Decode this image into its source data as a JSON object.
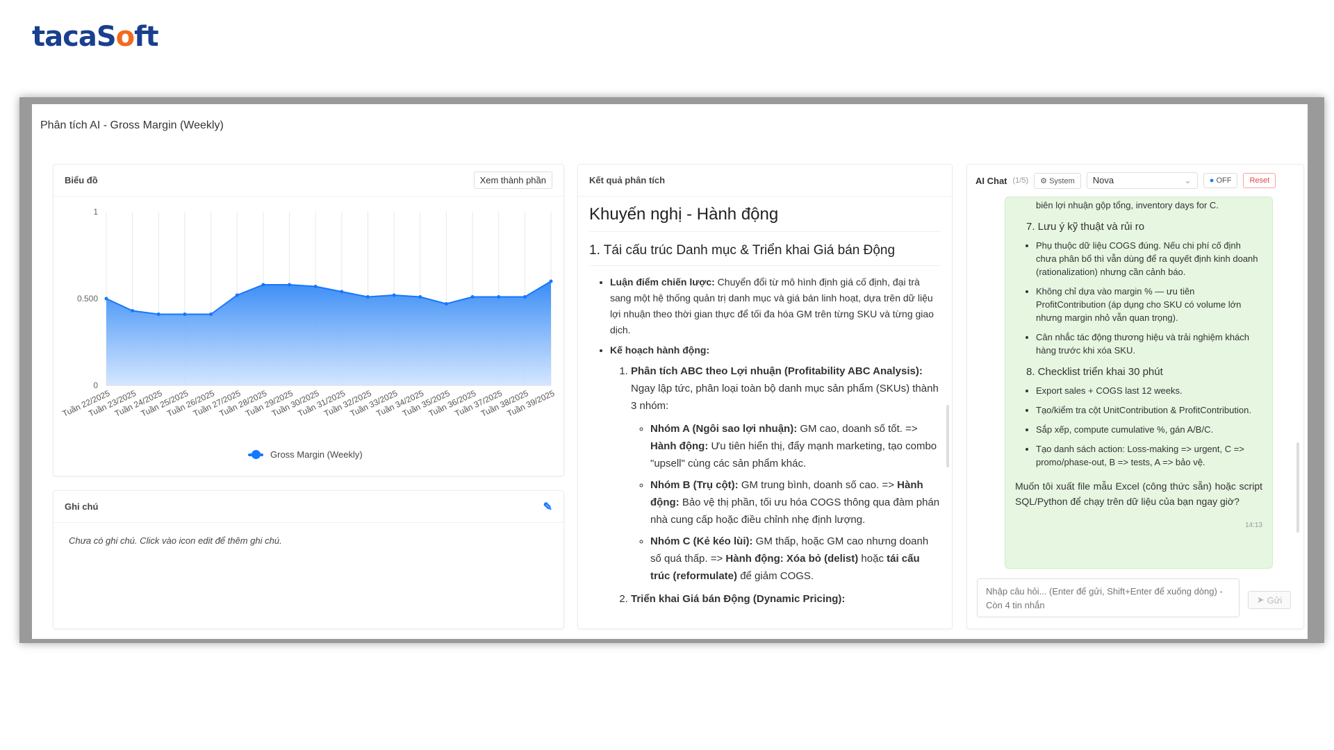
{
  "brand": {
    "name_before": "tacaS",
    "name_o": "o",
    "name_after": "ft"
  },
  "window": {
    "title": "Phân tích AI - Gross Margin (Weekly)"
  },
  "chart_panel": {
    "title": "Biểu đồ",
    "view_components_button": "Xem thành phần"
  },
  "chart_data": {
    "type": "area",
    "x": [
      "Tuần 22/2025",
      "Tuần 23/2025",
      "Tuần 24/2025",
      "Tuần 25/2025",
      "Tuần 26/2025",
      "Tuần 27/2025",
      "Tuần 28/2025",
      "Tuần 29/2025",
      "Tuần 30/2025",
      "Tuần 31/2025",
      "Tuần 32/2025",
      "Tuần 33/2025",
      "Tuần 34/2025",
      "Tuần 35/2025",
      "Tuần 36/2025",
      "Tuần 37/2025",
      "Tuần 38/2025",
      "Tuần 39/2025"
    ],
    "series": [
      {
        "name": "Gross Margin (Weekly)",
        "values": [
          0.5,
          0.43,
          0.41,
          0.41,
          0.41,
          0.52,
          0.58,
          0.58,
          0.57,
          0.54,
          0.51,
          0.52,
          0.51,
          0.47,
          0.51,
          0.51,
          0.51,
          0.6
        ]
      }
    ],
    "yticks": [
      "0",
      "0.500",
      "1"
    ],
    "ylim": [
      0,
      1
    ],
    "color": "#1677ff",
    "grid": "vertical",
    "legend": "bottom"
  },
  "notes_panel": {
    "title": "Ghi chú",
    "empty_text": "Chưa có ghi chú. Click vào icon edit để thêm ghi chú."
  },
  "result_panel": {
    "title": "Kết quả phân tích",
    "heading": "Khuyến nghị - Hành động",
    "section_title": "1. Tái cấu trúc Danh mục & Triển khai Giá bán Động",
    "strategy_label": "Luận điểm chiến lược:",
    "strategy_text": " Chuyển đổi từ mô hình định giá cố định, đại trà sang một hệ thống quản trị danh mục và giá bán linh hoạt, dựa trên dữ liệu lợi nhuận theo thời gian thực để tối đa hóa GM trên từng SKU và từng giao dịch.",
    "plan_label": "Kế hoạch hành động:",
    "step1_title": "Phân tích ABC theo Lợi nhuận (Profitability ABC Analysis):",
    "step1_text": " Ngay lập tức, phân loại toàn bộ danh mục sản phẩm (SKUs) thành 3 nhóm:",
    "groupA_label": "Nhóm A (Ngôi sao lợi nhuận):",
    "groupA_text": " GM cao, doanh số tốt. => ",
    "groupA_action_label": "Hành động:",
    "groupA_action": " Ưu tiên hiển thị, đẩy mạnh marketing, tạo combo \"upsell\" cùng các sản phẩm khác.",
    "groupB_label": "Nhóm B (Trụ cột):",
    "groupB_text": " GM trung bình, doanh số cao. => ",
    "groupB_action_label": "Hành động:",
    "groupB_action": " Bảo vệ thị phần, tối ưu hóa COGS thông qua đàm phán nhà cung cấp hoặc điều chỉnh nhẹ định lượng.",
    "groupC_label": "Nhóm C (Kẻ kéo lùi):",
    "groupC_text": " GM thấp, hoặc GM cao nhưng doanh số quá thấp. => ",
    "groupC_action_label": "Hành động: Xóa bỏ (delist)",
    "groupC_mid": " hoặc ",
    "groupC_reform": "tái cấu trúc (reformulate)",
    "groupC_end": " để giảm COGS.",
    "step2_title": "Triển khai Giá bán Động (Dynamic Pricing):"
  },
  "chat_panel": {
    "title": "AI Chat",
    "count": "(1/5)",
    "system_chip": "System",
    "model": "Nova",
    "toggle": "OFF",
    "reset": "Reset",
    "messages": {
      "line0": "biên lợi nhuận gộp tổng, inventory days for C.",
      "sec7": "7.  Lưu ý kỹ thuật và rủi ro",
      "b7_1": "Phụ thuộc dữ liệu COGS đúng. Nếu chi phí cố định chưa phân bổ thì vẫn dùng để ra quyết định kinh doanh (rationalization) nhưng cần cảnh báo.",
      "b7_2": "Không chỉ dựa vào margin % — ưu tiên ProfitContribution (áp dụng cho SKU có volume lớn nhưng margin nhỏ vẫn quan trọng).",
      "b7_3": "Cân nhắc tác động thương hiệu và trải nghiệm khách hàng trước khi xóa SKU.",
      "sec8": "8.  Checklist triển khai 30 phút",
      "b8_1": "Export sales + COGS last 12 weeks.",
      "b8_2": "Tạo/kiểm tra cột UnitContribution & ProfitContribution.",
      "b8_3": "Sắp xếp, compute cumulative %, gán A/B/C.",
      "b8_4": "Tạo danh sách action: Loss-making => urgent, C => promo/phase-out, B => tests, A => bảo vệ.",
      "closing": "Muốn tôi xuất file mẫu Excel (công thức sẵn) hoặc script SQL/Python để chạy trên dữ liệu của bạn ngay giờ?",
      "time": "14:13"
    },
    "input_placeholder": "Nhập câu hỏi... (Enter để gửi, Shift+Enter để xuống dòng) - Còn 4 tin nhắn",
    "send": "Gửi"
  }
}
